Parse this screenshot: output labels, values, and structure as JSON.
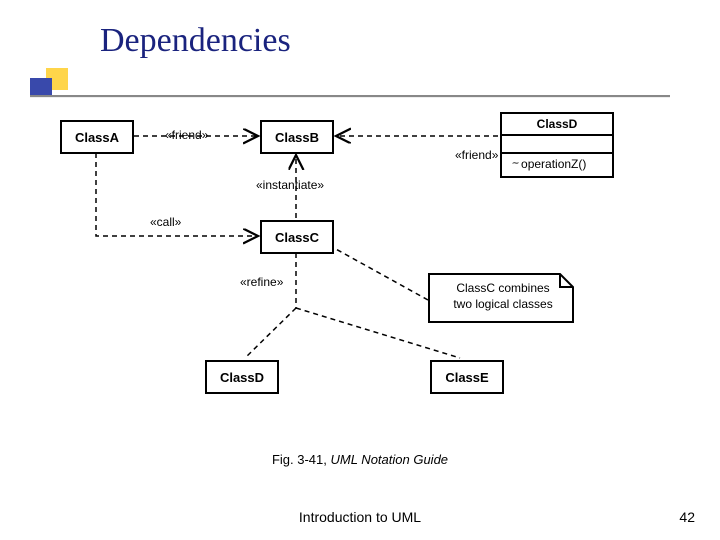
{
  "slide": {
    "title": "Dependencies",
    "caption_prefix": "Fig. 3-41, ",
    "caption_italic": "UML Notation Guide",
    "footer": "Introduction to UML",
    "page_number": "42"
  },
  "diagram": {
    "classes": {
      "classA": "ClassA",
      "classB": "ClassB",
      "classC": "ClassC",
      "classD": "ClassD",
      "classD_full_name": "ClassD",
      "classD_full_op": "operationZ()",
      "classE": "ClassE"
    },
    "stereotypes": {
      "friend_ab": "«friend»",
      "friend_db": "«friend»",
      "instantiate": "«instantiate»",
      "call": "«call»",
      "refine": "«refine»"
    },
    "note": {
      "line1": "ClassC combines",
      "line2": "two logical classes"
    }
  }
}
